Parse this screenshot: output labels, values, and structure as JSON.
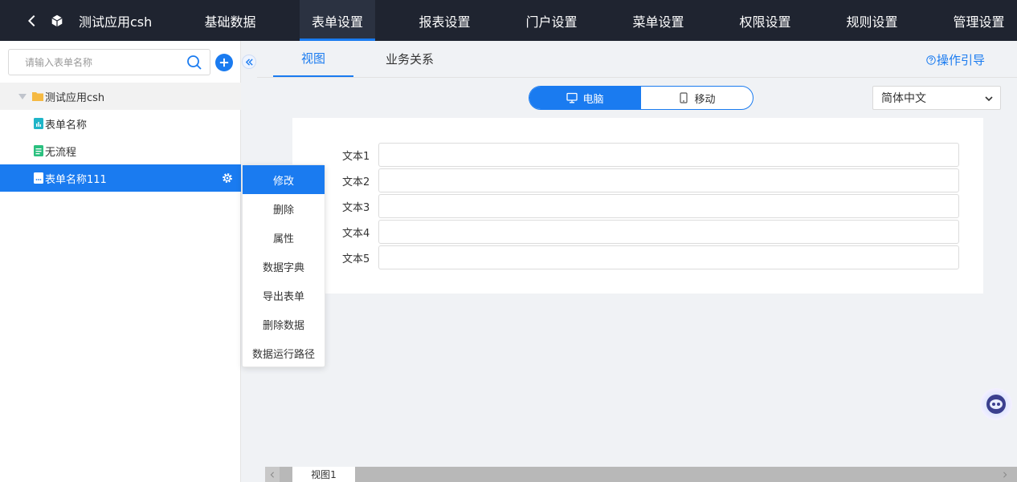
{
  "topbar": {
    "app_name": "测试应用csh",
    "nav": [
      {
        "label": "基础数据",
        "active": false
      },
      {
        "label": "表单设置",
        "active": true
      },
      {
        "label": "报表设置",
        "active": false
      },
      {
        "label": "门户设置",
        "active": false
      },
      {
        "label": "菜单设置",
        "active": false
      },
      {
        "label": "权限设置",
        "active": false
      },
      {
        "label": "规则设置",
        "active": false
      },
      {
        "label": "管理设置",
        "active": false
      }
    ]
  },
  "sidebar": {
    "search_placeholder": "请输入表单名称",
    "tree": {
      "root_label": "测试应用csh",
      "items": [
        {
          "label": "表单名称",
          "selected": false
        },
        {
          "label": "无流程",
          "selected": false
        },
        {
          "label": "表单名称111",
          "selected": true
        }
      ]
    }
  },
  "context_menu": {
    "items": [
      "修改",
      "删除",
      "属性",
      "数据字典",
      "导出表单",
      "删除数据",
      "数据运行路径"
    ]
  },
  "main": {
    "tabs": [
      {
        "label": "视图",
        "active": true
      },
      {
        "label": "业务关系",
        "active": false
      }
    ],
    "guide_label": "操作引导",
    "device": {
      "desktop_label": "电脑",
      "mobile_label": "移动"
    },
    "language": "简体中文",
    "fields": [
      "文本1",
      "文本2",
      "文本3",
      "文本4",
      "文本5"
    ],
    "sheet_tab": "视图1"
  },
  "colors": {
    "accent": "#1a7bf0",
    "topbar": "#1f2430"
  }
}
